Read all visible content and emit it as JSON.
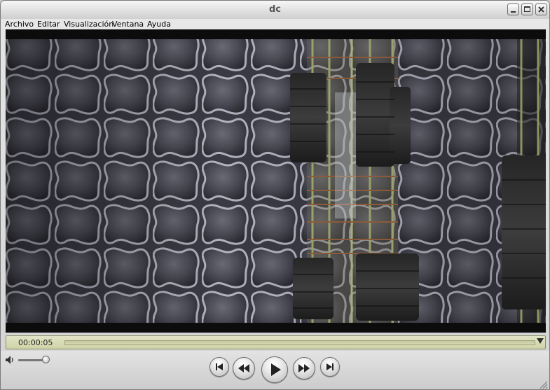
{
  "window": {
    "title": "dc",
    "controls": {
      "minimize": "minimize-icon",
      "maximize": "maximize-icon",
      "close": "close-icon"
    }
  },
  "menu": {
    "items": [
      "Archivo",
      "Editar",
      "Visualización",
      "Ventana",
      "Ayuda"
    ]
  },
  "player": {
    "timecode": "00:00:05",
    "accent": "#d6d9b0",
    "controls": [
      "skip-to-start-icon",
      "rewind-icon",
      "play-icon",
      "fast-forward-icon",
      "skip-to-end-icon"
    ],
    "volume_icon": "speaker-icon"
  }
}
